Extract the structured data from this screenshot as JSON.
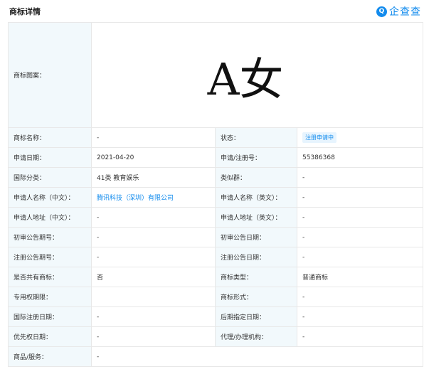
{
  "header": {
    "title": "商标详情",
    "logo_mark": "Q",
    "logo_text": "企查查"
  },
  "trademark": {
    "image_label": "商标图案：",
    "image_text": "A女"
  },
  "rows": [
    {
      "l1": "商标名称：",
      "v1": "-",
      "l2": "状态：",
      "v2": "注册申请中"
    },
    {
      "l1": "申请日期：",
      "v1": "2021-04-20",
      "l2": "申请/注册号：",
      "v2": "55386368"
    },
    {
      "l1": "国际分类：",
      "v1": "41类 教育娱乐",
      "l2": "类似群：",
      "v2": "-"
    },
    {
      "l1": "申请人名称（中文）：",
      "v1": "腾讯科技（深圳）有限公司",
      "l2": "申请人名称（英文）：",
      "v2": "-"
    },
    {
      "l1": "申请人地址（中文）：",
      "v1": "-",
      "l2": "申请人地址（英文）：",
      "v2": "-"
    },
    {
      "l1": "初审公告期号：",
      "v1": "-",
      "l2": "初审公告日期：",
      "v2": "-"
    },
    {
      "l1": "注册公告期号：",
      "v1": "-",
      "l2": "注册公告日期：",
      "v2": "-"
    },
    {
      "l1": "是否共有商标：",
      "v1": "否",
      "l2": "商标类型：",
      "v2": "普通商标"
    },
    {
      "l1": "专用权期限：",
      "v1": "",
      "l2": "商标形式：",
      "v2": "-"
    },
    {
      "l1": "国际注册日期：",
      "v1": "-",
      "l2": "后期指定日期：",
      "v2": "-"
    },
    {
      "l1": "优先权日期：",
      "v1": "-",
      "l2": "代理/办理机构：",
      "v2": "-"
    }
  ],
  "last_row": {
    "l1": "商品/服务：",
    "v1": "-"
  },
  "colors": {
    "accent": "#128bed",
    "label_bg": "#f2f9fc",
    "border": "#e8e8e8"
  }
}
